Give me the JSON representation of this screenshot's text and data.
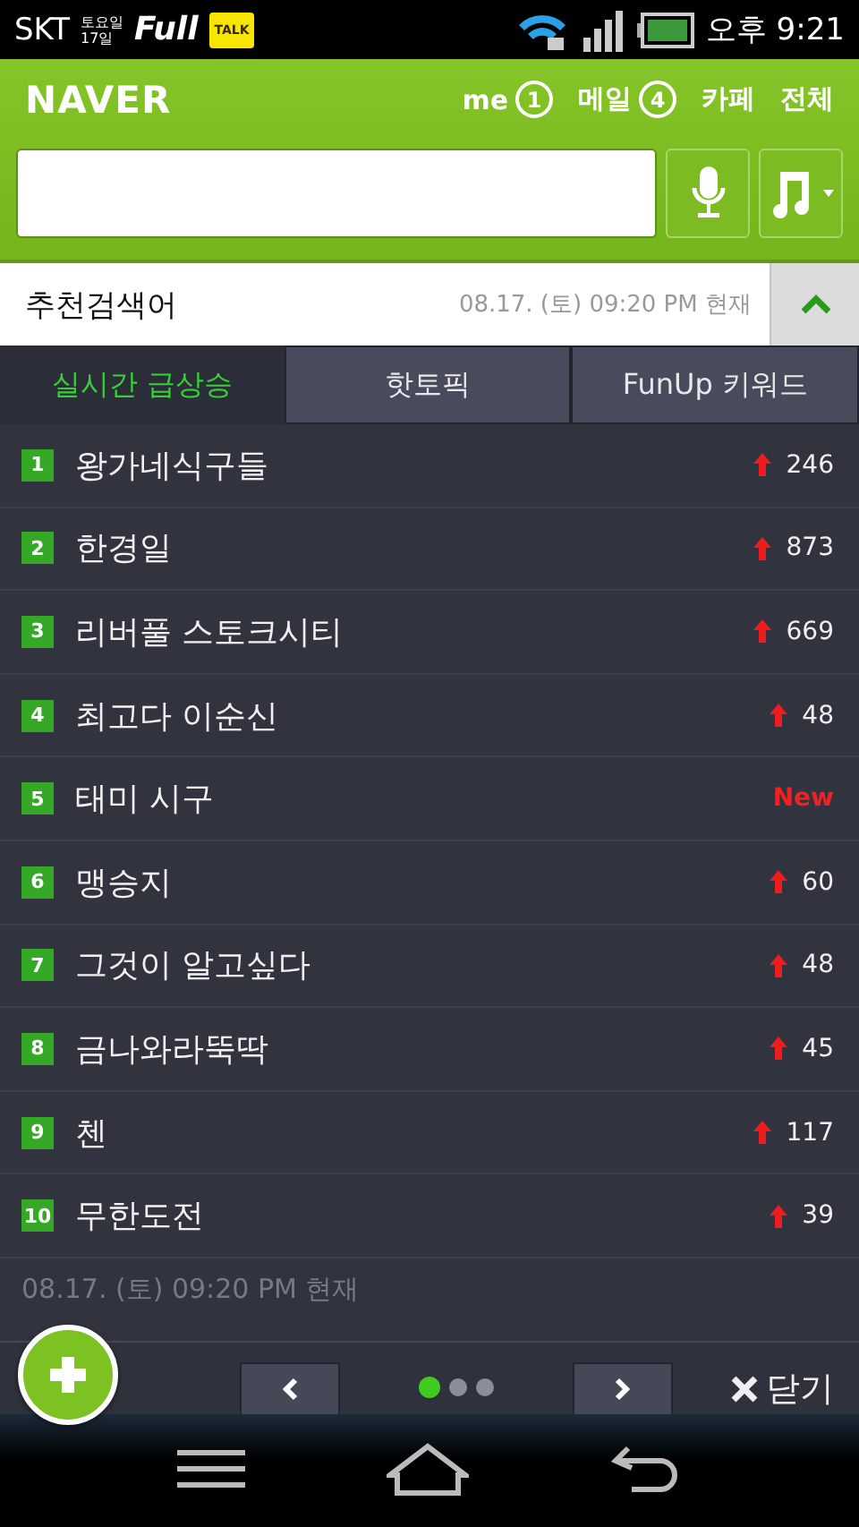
{
  "status_bar": {
    "carrier": "SKT",
    "date_lines": [
      "토요일",
      "17일"
    ],
    "badge": "Full",
    "talk_icon": "TALK",
    "time": "오후 9:21"
  },
  "header": {
    "logo": "NAVER",
    "links": [
      {
        "label": "me",
        "count": "1"
      },
      {
        "label": "메일",
        "count": "4"
      },
      {
        "label": "카페"
      },
      {
        "label": "전체"
      }
    ]
  },
  "recommend": {
    "title": "추천검색어",
    "timestamp": "08.17. (토) 09:20 PM 현재",
    "expanded": true
  },
  "tabs": [
    {
      "label": "실시간 급상승",
      "selected": true
    },
    {
      "label": "핫토픽",
      "selected": false
    },
    {
      "label": "FunUp 키워드",
      "selected": false
    }
  ],
  "rows": [
    {
      "rank": "1",
      "term": "왕가네식구들",
      "kind": "up",
      "change": "246"
    },
    {
      "rank": "2",
      "term": "한경일",
      "kind": "up",
      "change": "873"
    },
    {
      "rank": "3",
      "term": "리버풀 스토크시티",
      "kind": "up",
      "change": "669"
    },
    {
      "rank": "4",
      "term": "최고다 이순신",
      "kind": "up",
      "change": "48"
    },
    {
      "rank": "5",
      "term": "태미 시구",
      "kind": "new",
      "change": "New"
    },
    {
      "rank": "6",
      "term": "맹승지",
      "kind": "up",
      "change": "60"
    },
    {
      "rank": "7",
      "term": "그것이 알고싶다",
      "kind": "up",
      "change": "48"
    },
    {
      "rank": "8",
      "term": "금나와라뚝딱",
      "kind": "up",
      "change": "45"
    },
    {
      "rank": "9",
      "term": "첸",
      "kind": "up",
      "change": "117"
    },
    {
      "rank": "10",
      "term": "무한도전",
      "kind": "up",
      "change": "39"
    }
  ],
  "footer_timestamp": "08.17. (토) 09:20 PM 현재",
  "pager": {
    "pages": [
      {
        "selected": true
      },
      {
        "selected": false
      },
      {
        "selected": false
      }
    ],
    "close_label": "닫기"
  }
}
